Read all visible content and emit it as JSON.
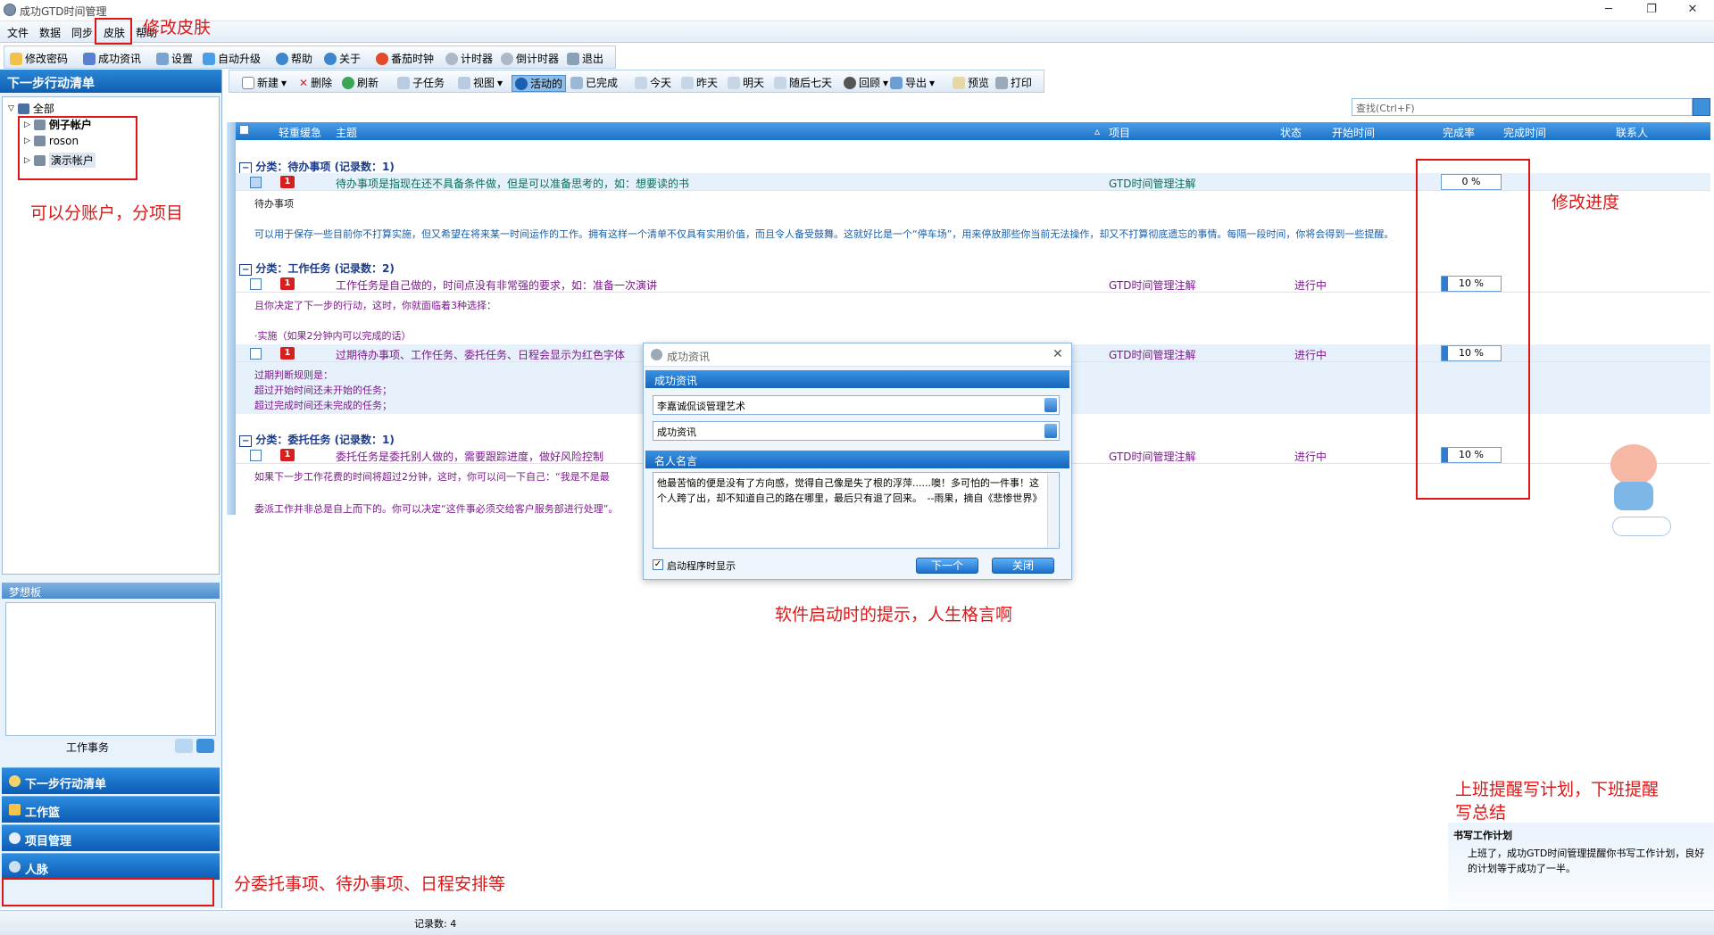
{
  "window": {
    "title": "成功GTD时间管理"
  },
  "menu": [
    "文件",
    "数据",
    "同步",
    "皮肤",
    "帮助"
  ],
  "toolbar1": [
    "修改密码",
    "成功资讯",
    "设置",
    "自动升级",
    "帮助",
    "关于",
    "番茄时钟",
    "计时器",
    "倒计时器",
    "退出"
  ],
  "toolbar2": [
    "新建",
    "删除",
    "刷新",
    "子任务",
    "视图",
    "活动的",
    "已完成",
    "今天",
    "昨天",
    "明天",
    "随后七天",
    "回顾",
    "导出",
    "预览",
    "打印"
  ],
  "left": {
    "header": "下一步行动清单",
    "tree": {
      "root": "全部",
      "items": [
        "例子帐户",
        "roson",
        "演示帐户"
      ]
    },
    "dream": {
      "header": "梦想板",
      "footer": "工作事务"
    },
    "nav": [
      "下一步行动清单",
      "工作篮",
      "项目管理",
      "人脉"
    ]
  },
  "search": {
    "placeholder": "查找(Ctrl+F)"
  },
  "columns": [
    "轻重缓急",
    "主题",
    "项目",
    "状态",
    "开始时间",
    "完成率",
    "完成时间",
    "联系人"
  ],
  "groups": [
    {
      "label": "分类：待办事项 (记录数：1)",
      "rows": [
        {
          "subject": "待办事项是指现在还不具备条件做，但是可以准备思考的，如：想要读的书",
          "project": "GTD时间管理注解",
          "status": "",
          "progress": 0,
          "progress_label": "0 %",
          "notes": [
            "待办事项",
            "可以用于保存一些目前你不打算实施，但又希望在将来某一时间运作的工作。拥有这样一个清单不仅具有实用价值，而且令人备受鼓舞。这就好比是一个“停车场”，用来停放那些你当前无法操作，却又不打算彻底遗忘的事情。每隔一段时间，你将会得到一些提醒。"
          ]
        }
      ]
    },
    {
      "label": "分类：工作任务 (记录数：2)",
      "rows": [
        {
          "subject": "工作任务是自己做的，时间点没有非常强的要求，如：准备一次演讲",
          "project": "GTD时间管理注解",
          "status": "进行中",
          "progress": 10,
          "progress_label": "10 %",
          "notes": [
            "且你决定了下一步的行动，这时，你就面临着3种选择：",
            "·实施（如果2分钟内可以完成的话）"
          ]
        },
        {
          "subject": "过期待办事项、工作任务、委托任务、日程会显示为红色字体",
          "project": "GTD时间管理注解",
          "status": "进行中",
          "progress": 10,
          "progress_label": "10 %",
          "notes": [
            "过期判断规则是：",
            "超过开始时间还未开始的任务；",
            "超过完成时间还未完成的任务；"
          ]
        }
      ]
    },
    {
      "label": "分类：委托任务 (记录数：1)",
      "rows": [
        {
          "subject": "委托任务是委托别人做的，需要跟踪进度，做好风险控制",
          "project": "GTD时间管理注解",
          "status": "进行中",
          "progress": 10,
          "progress_label": "10 %",
          "notes": [
            "如果下一步工作花费的时间将超过2分钟，这时，你可以问一下自己：“我是不是最",
            "委派工作并非总是自上而下的。你可以决定“这件事必须交给客户服务部进行处理”。"
          ]
        }
      ]
    }
  ],
  "dialog": {
    "title": "成功资讯",
    "section1": "成功资讯",
    "combo1": "李嘉诚侃谈管理艺术",
    "combo2": "成功资讯",
    "section2": "名人名言",
    "quote": "他最苦恼的便是没有了方向感，觉得自己像是失了根的浮萍......噢！多可怕的一件事！这个人跨了出，却不知道自己的路在哪里，最后只有退了回来。　--雨果，摘自《悲惨世界》",
    "checkbox": "启动程序时显示",
    "next": "下一个",
    "close": "关闭"
  },
  "notification": {
    "title": "书写工作计划",
    "body": "上班了，成功GTD时间管理提醒你书写工作计划，良好的计划等于成功了一半。"
  },
  "status": {
    "records": "记录数: 4"
  },
  "annotations": {
    "skin": "修改皮肤",
    "accounts": "可以分账户，分项目",
    "progress": "修改进度",
    "startup": "软件启动时的提示，人生格言啊",
    "reminder1": "上班提醒写计划，下班提醒",
    "reminder2": "写总结",
    "categories": "分委托事项、待办事项、日程安排等"
  },
  "colors": {
    "accent": "#1c72c8",
    "annotation": "#e01616",
    "flag": "#d62020"
  }
}
